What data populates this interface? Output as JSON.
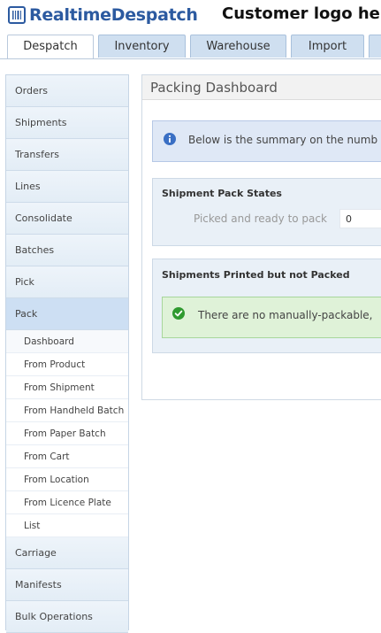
{
  "header": {
    "brand": "RealtimeDespatch",
    "customer_logo": "Customer logo he"
  },
  "tabs": [
    {
      "label": "Despatch",
      "active": true
    },
    {
      "label": "Inventory"
    },
    {
      "label": "Warehouse"
    },
    {
      "label": "Import"
    }
  ],
  "sidebar": {
    "items": [
      {
        "label": "Orders"
      },
      {
        "label": "Shipments"
      },
      {
        "label": "Transfers"
      },
      {
        "label": "Lines"
      },
      {
        "label": "Consolidate"
      },
      {
        "label": "Batches"
      },
      {
        "label": "Pick"
      },
      {
        "label": "Pack",
        "active": true
      }
    ],
    "pack_subitems": [
      {
        "label": "Dashboard",
        "current": true
      },
      {
        "label": "From Product"
      },
      {
        "label": "From Shipment"
      },
      {
        "label": "From Handheld Batch"
      },
      {
        "label": "From Paper Batch"
      },
      {
        "label": "From Cart"
      },
      {
        "label": "From Location"
      },
      {
        "label": "From Licence Plate"
      },
      {
        "label": "List"
      }
    ],
    "lower_items": [
      {
        "label": "Carriage"
      },
      {
        "label": "Manifests"
      },
      {
        "label": "Bulk Operations"
      }
    ]
  },
  "main": {
    "title": "Packing Dashboard",
    "info_text": "Below is the summary on the numb",
    "pack_states": {
      "title": "Shipment Pack States",
      "field_label": "Picked and ready to pack",
      "field_value": "0"
    },
    "printed_not_packed": {
      "title": "Shipments Printed but not Packed",
      "message": "There are no manually-packable,"
    }
  },
  "colors": {
    "brand": "#2c5aa0",
    "info_icon": "#3a6fc4",
    "success_icon": "#2f9a2f"
  }
}
